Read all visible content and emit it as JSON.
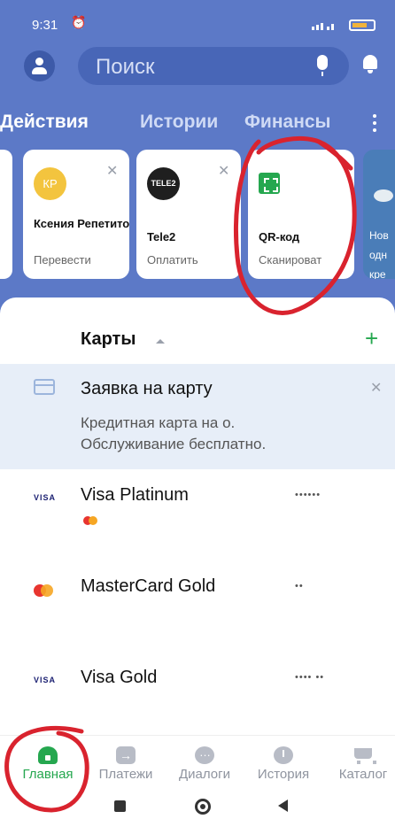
{
  "status_bar": {
    "time": "9:31"
  },
  "header": {
    "search_placeholder": "Поиск",
    "tabs": [
      {
        "label": "Действия",
        "active": true
      },
      {
        "label": "Истории",
        "active": false
      },
      {
        "label": "Финансы",
        "active": false
      }
    ]
  },
  "action_cards": [
    {
      "icon_text": "КР",
      "title": "Ксения Репетитор",
      "subtitle": "Перевести"
    },
    {
      "icon_text": "TELE2",
      "title": "Tele2",
      "subtitle": "Оплатить"
    },
    {
      "icon": "qr-code-icon",
      "title": "QR-код",
      "subtitle": "Сканироват"
    }
  ],
  "promo_card": {
    "lines": [
      "Нов",
      "одн",
      "кре"
    ]
  },
  "cards_section": {
    "title": "Карты",
    "add_symbol": "+"
  },
  "card_application": {
    "title": "Заявка на карту",
    "desc_line1": "Кредитная карта на        о.",
    "desc_line2": "Обслуживание бесплатно."
  },
  "cards": [
    {
      "logo": "VISA",
      "name": "Visa Platinum",
      "number_mask": "••••••"
    },
    {
      "logo": "mastercard",
      "name": "MasterCard Gold",
      "number_mask": "••"
    },
    {
      "logo": "VISA",
      "name": "Visa Gold",
      "number_mask": "•••• ••"
    }
  ],
  "bottom_nav": [
    {
      "label": "Главная",
      "active": true,
      "icon": "home-icon"
    },
    {
      "label": "Платежи",
      "active": false,
      "icon": "payments-icon"
    },
    {
      "label": "Диалоги",
      "active": false,
      "icon": "chat-icon"
    },
    {
      "label": "История",
      "active": false,
      "icon": "clock-icon"
    },
    {
      "label": "Каталог",
      "active": false,
      "icon": "cart-icon"
    }
  ],
  "colors": {
    "header_blue": "#5c79c7",
    "accent_green": "#25a74f",
    "annotation_red": "#d9232e"
  }
}
